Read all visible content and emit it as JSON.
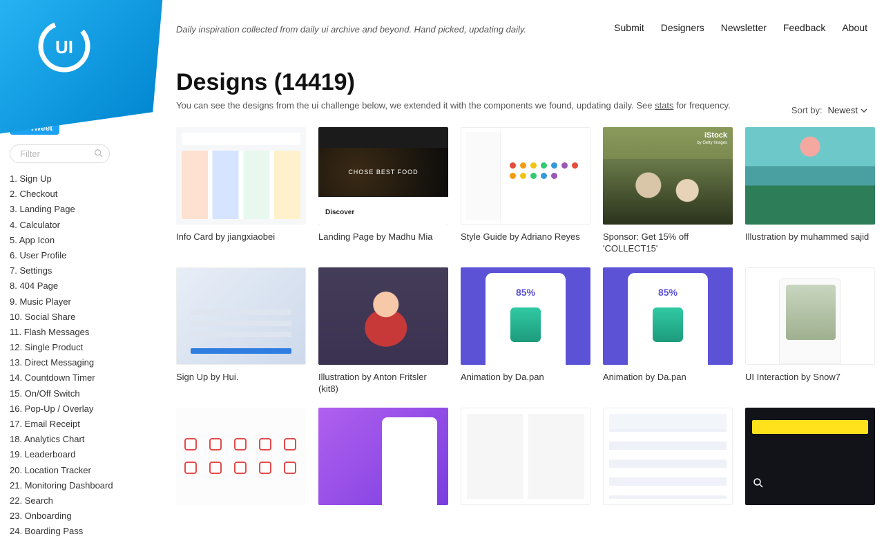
{
  "tagline": "Daily inspiration collected from daily ui archive and beyond. Hand picked, updating daily.",
  "nav": {
    "submit": "Submit",
    "designers": "Designers",
    "newsletter": "Newsletter",
    "feedback": "Feedback",
    "about": "About"
  },
  "tweet_label": "Tweet",
  "filter_placeholder": "Filter",
  "sidebar_items": [
    "1. Sign Up",
    "2. Checkout",
    "3. Landing Page",
    "4. Calculator",
    "5. App Icon",
    "6. User Profile",
    "7. Settings",
    "8. 404 Page",
    "9. Music Player",
    "10. Social Share",
    "11. Flash Messages",
    "12. Single Product",
    "13. Direct Messaging",
    "14. Countdown Timer",
    "15. On/Off Switch",
    "16. Pop-Up / Overlay",
    "17. Email Receipt",
    "18. Analytics Chart",
    "19. Leaderboard",
    "20. Location Tracker",
    "21. Monitoring Dashboard",
    "22. Search",
    "23. Onboarding",
    "24. Boarding Pass"
  ],
  "page_title": "Designs (14419)",
  "page_sub_pre": "You can see the designs from the ui challenge below, we extended it with the components we found, updating daily. See ",
  "page_sub_link": "stats",
  "page_sub_post": " for frequency.",
  "sortby_label": "Sort by:",
  "sortby_value": "Newest",
  "istock": {
    "brand": "iStock",
    "sub": "by Getty Images"
  },
  "th2_title": "CHOSE BEST FOOD",
  "th2_discover": "Discover",
  "th8_pct": "85%",
  "th9_pct": "85%",
  "cards": [
    {
      "caption": "Info Card by jiangxiaobei"
    },
    {
      "caption": "Landing Page by Madhu Mia"
    },
    {
      "caption": "Style Guide by Adriano Reyes"
    },
    {
      "caption": "Sponsor: Get 15% off 'COLLECT15'"
    },
    {
      "caption": "Illustration by muhammed sajid"
    },
    {
      "caption": "Sign Up by Hui."
    },
    {
      "caption": "Illustration by Anton Fritsler (kit8)"
    },
    {
      "caption": "Animation by Da.pan"
    },
    {
      "caption": "Animation by Da.pan"
    },
    {
      "caption": "UI Interaction by Snow7"
    }
  ]
}
